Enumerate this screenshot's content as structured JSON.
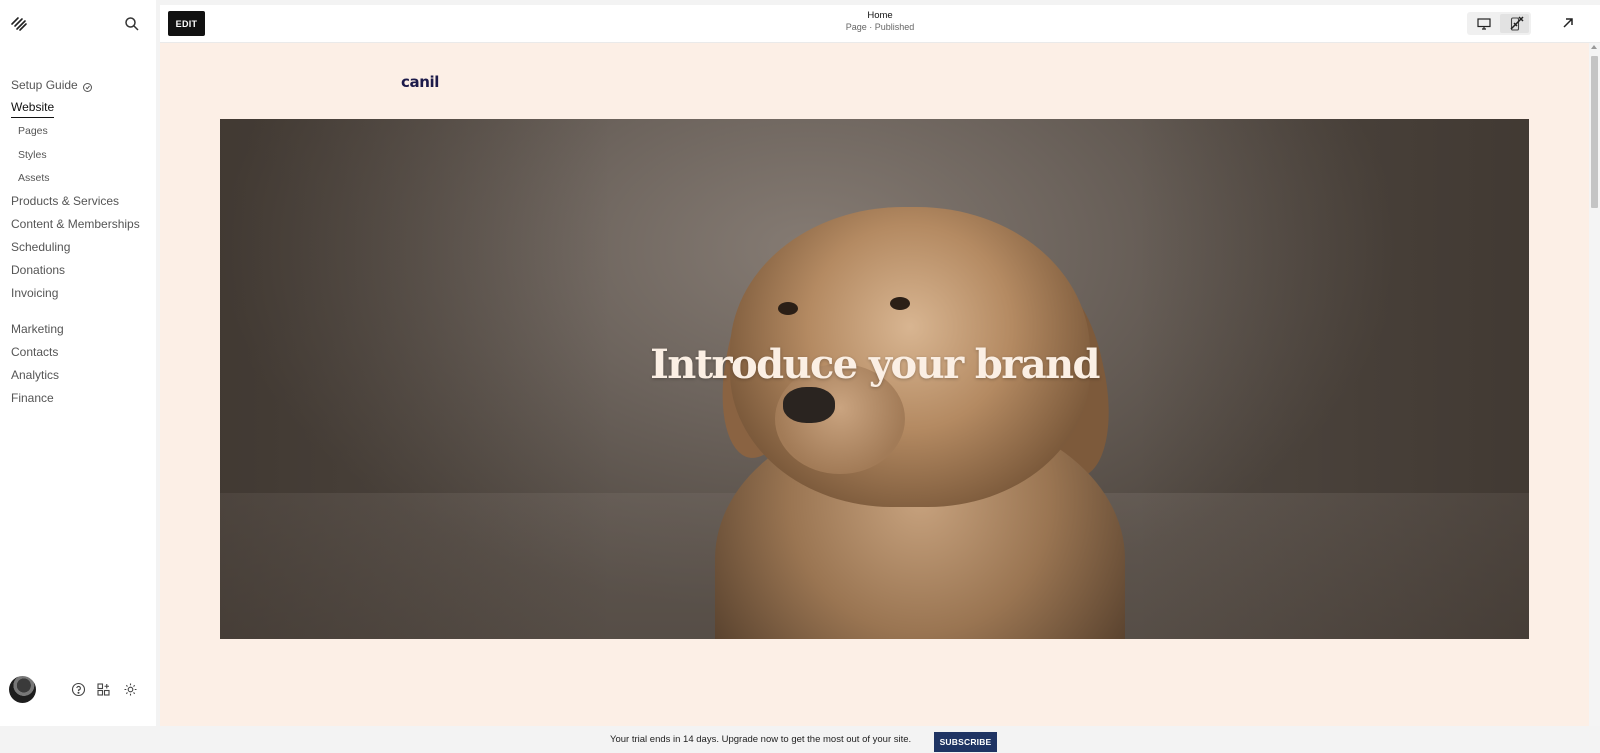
{
  "sidebar": {
    "logo_icon": "squarespace-logo-icon",
    "search_icon": "search-icon",
    "setup_guide": "Setup Guide",
    "website": "Website",
    "website_sub": [
      "Pages",
      "Styles",
      "Assets"
    ],
    "section1": [
      "Products & Services",
      "Content & Memberships",
      "Scheduling",
      "Donations",
      "Invoicing"
    ],
    "section2": [
      "Marketing",
      "Contacts",
      "Analytics",
      "Finance"
    ],
    "footer_icons": [
      "help-icon",
      "apps-icon",
      "settings-icon"
    ]
  },
  "topbar": {
    "edit_label": "EDIT",
    "page_title": "Home",
    "page_status": "Page · Published",
    "device_active": "mobile"
  },
  "canvas": {
    "site_title": "canil",
    "hero_heading": "Introduce your brand"
  },
  "banner": {
    "trial_text": "Your trial ends in 14 days. Upgrade now to get the most out of your site.",
    "subscribe_label": "SUBSCRIBE"
  },
  "colors": {
    "canvas_bg": "#fcefe6",
    "subscribe_bg": "#1f3463",
    "site_title": "#1c1a4a",
    "edit_bg": "#111111"
  }
}
